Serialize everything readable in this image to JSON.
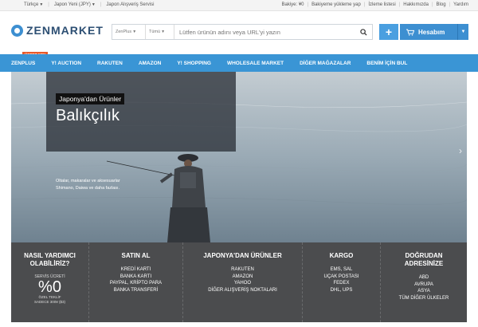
{
  "topbar": {
    "language": "Türkçe",
    "currency": "Japon Yeni (JPY)",
    "service": "Japon Alışveriş Servisi",
    "balance": "Bakiye: ¥0",
    "topup": "Bakiyeme yükleme yap",
    "wishlist": "İzleme listesi",
    "about": "Hakkımızda",
    "blog": "Blog",
    "help": "Yardım"
  },
  "header": {
    "logo": "ZENMARKET",
    "search_source": "ZenPlus",
    "search_category": "Tümü",
    "search_placeholder": "Lütfen ürünün adını veya URL'yi yazın",
    "account_label": "Hesabım",
    "plus_label": "+"
  },
  "nav": {
    "promo_badge": "ÜCRET YOK",
    "items": [
      "ZENPLUS",
      "Y! AUCTION",
      "RAKUTEN",
      "AMAZON",
      "Y! SHOPPING",
      "WHOLESALE MARKET",
      "DİĞER MAĞAZALAR",
      "BENİM İÇİN BUL"
    ]
  },
  "hero": {
    "tag": "Japonya'dan Ürünler",
    "title": "Balıkçılık",
    "desc_line1": "Oltalar, makaralar ve aksesuarlar",
    "desc_line2": "Shimano, Daiwa ve daha fazlası."
  },
  "footer": {
    "help": {
      "title_line1": "NASIL YARDIMCI",
      "title_line2": "OLABİLİRİZ?",
      "fee_label": "SERVİS ÜCRETİ",
      "fee_value": "%0",
      "offer_line1": "ÖZEL TEKLİF",
      "offer_line2": "SADECE 300¥ ($3)"
    },
    "buy": {
      "title": "SATIN AL",
      "links": [
        "KREDİ KARTI",
        "BANKA KARTI",
        "PAYPAL, KRİPTO PARA",
        "BANKA TRANSFERİ"
      ]
    },
    "products": {
      "title": "JAPONYA'DAN ÜRÜNLER",
      "links": [
        "RAKUTEN",
        "AMAZON",
        "YAHOO",
        "DİĞER ALIŞVERİŞ NOKTALARI"
      ]
    },
    "cargo": {
      "title": "KARGO",
      "links": [
        "EMS, SAL",
        "UÇAK POSTASI",
        "FEDEX",
        "DHL, UPS"
      ]
    },
    "direct": {
      "title_line1": "DOĞRUDAN",
      "title_line2": "ADRESİNİZE",
      "links": [
        "ABD",
        "AVRUPA",
        "ASYA",
        "TÜM DİĞER ÜLKELER"
      ]
    }
  },
  "colors": {
    "nav_blue": "#3a95d5",
    "account_blue": "#3d8fd1",
    "footer_gray": "#4b4c4e",
    "promo_orange": "#e85a2a"
  }
}
